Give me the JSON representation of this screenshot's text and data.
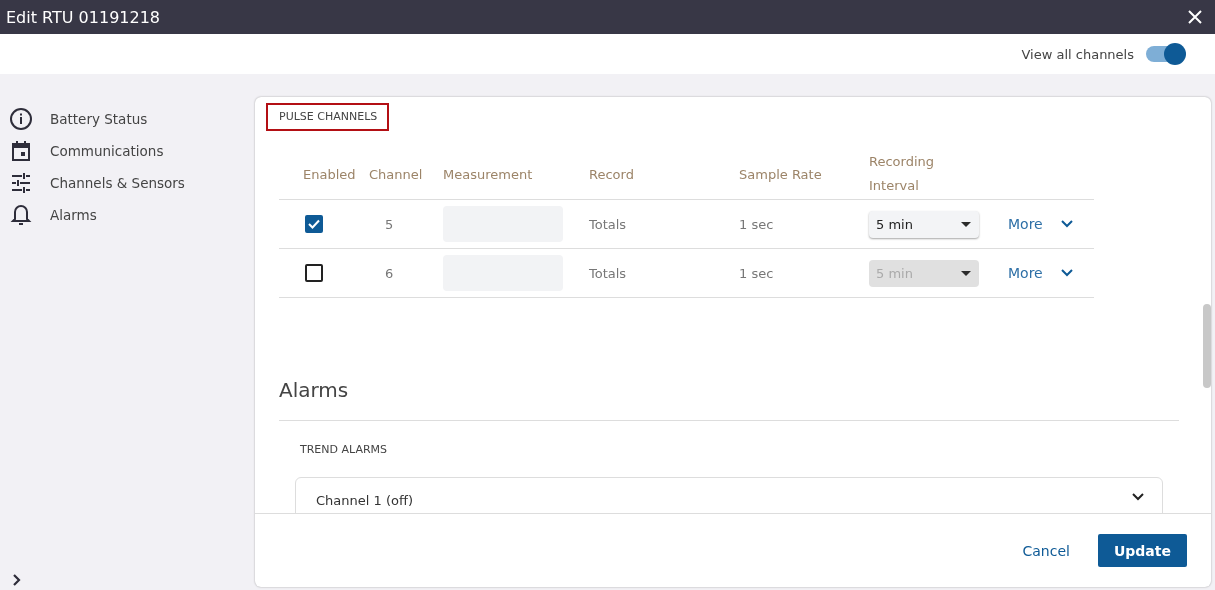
{
  "window": {
    "title": "Edit RTU 01191218"
  },
  "view_all_channels": {
    "label": "View all channels",
    "on": true
  },
  "sidebar": {
    "items": [
      {
        "label": "Battery Status",
        "kind": "info"
      },
      {
        "label": "Communications",
        "kind": "calendar"
      },
      {
        "label": "Channels & Sensors",
        "kind": "sliders"
      },
      {
        "label": "Alarms",
        "kind": "bell"
      }
    ]
  },
  "pulse_channels": {
    "title": "PULSE CHANNELS",
    "columns": [
      "Enabled",
      "Channel",
      "Measurement",
      "Record",
      "Sample Rate",
      "Recording Interval"
    ],
    "rows": [
      {
        "enabled": true,
        "channel": "5",
        "record": "Totals",
        "sample_rate": "1 sec",
        "interval": "5 min",
        "interval_disabled": false,
        "more": "More"
      },
      {
        "enabled": false,
        "channel": "6",
        "record": "Totals",
        "sample_rate": "1 sec",
        "interval": "5 min",
        "interval_disabled": true,
        "more": "More"
      }
    ]
  },
  "alarms": {
    "heading": "Alarms",
    "section": "TREND ALARMS",
    "items": [
      {
        "label": "Channel 1 (off)"
      }
    ]
  },
  "buttons": {
    "cancel": "Cancel",
    "update": "Update"
  }
}
